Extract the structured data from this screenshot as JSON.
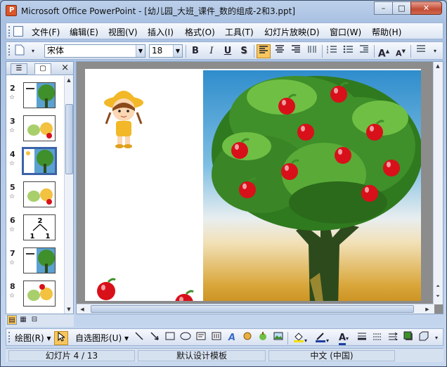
{
  "window": {
    "title": "Microsoft Office PowerPoint - [幼儿园_大班_课件_数的组成-2和3.ppt]",
    "min": "–",
    "max": "□",
    "close": "✕"
  },
  "menu": [
    "文件(F)",
    "编辑(E)",
    "视图(V)",
    "插入(I)",
    "格式(O)",
    "工具(T)",
    "幻灯片放映(D)",
    "窗口(W)",
    "帮助(H)"
  ],
  "toolbar": {
    "font": "宋体",
    "size": "18",
    "bold": "B",
    "italic": "I",
    "underline": "U",
    "shadow": "S",
    "grow": "A",
    "shrink": "A"
  },
  "panel": {
    "close": "×"
  },
  "slides": [
    {
      "num": "2",
      "star": "☆"
    },
    {
      "num": "3",
      "star": "☆"
    },
    {
      "num": "4",
      "star": "☆"
    },
    {
      "num": "5",
      "star": "☆"
    },
    {
      "num": "6",
      "star": "☆"
    },
    {
      "num": "7",
      "star": "☆"
    },
    {
      "num": "8",
      "star": "☆"
    }
  ],
  "slide6": {
    "top": "2",
    "left": "1",
    "right": "1"
  },
  "drawbar": {
    "draw": "绘图(R)",
    "autoshapes": "自选图形(U)"
  },
  "status": {
    "slide": "幻灯片 4 / 13",
    "template": "默认设计模板",
    "language": "中文 (中国)"
  },
  "colors": {
    "apple": "#d8101a",
    "leaf": "#3f8f2a",
    "trunk": "#2d4a1c",
    "selection": "#3c62a8"
  }
}
